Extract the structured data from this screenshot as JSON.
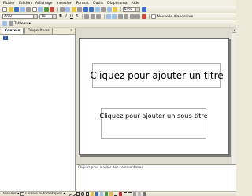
{
  "menu": [
    "Fichier",
    "Edition",
    "Affichage",
    "Insertion",
    "Format",
    "Outils",
    "Diaporama",
    "Aide"
  ],
  "toolbar": {
    "zoom": "54%",
    "font": "Arial",
    "size": "18",
    "bold": "B",
    "italic": "I",
    "underline": "U",
    "shadow": "S",
    "new_slide": "Nouvelle diapositive",
    "tableau": "Tableau"
  },
  "panes": {
    "tab_outline": "Contour",
    "tab_slides": "Diapositives",
    "close": "×",
    "thumb_num": "1"
  },
  "slide": {
    "title_placeholder": "Cliquez pour ajouter un titre",
    "subtitle_placeholder": "Cliquez pour ajouter un sous-titre"
  },
  "notes": {
    "placeholder": "Cliquez pour ajouter des commentaires"
  },
  "drawing": {
    "draw": "Dessiner",
    "autoshapes": "Formes automatiques"
  }
}
